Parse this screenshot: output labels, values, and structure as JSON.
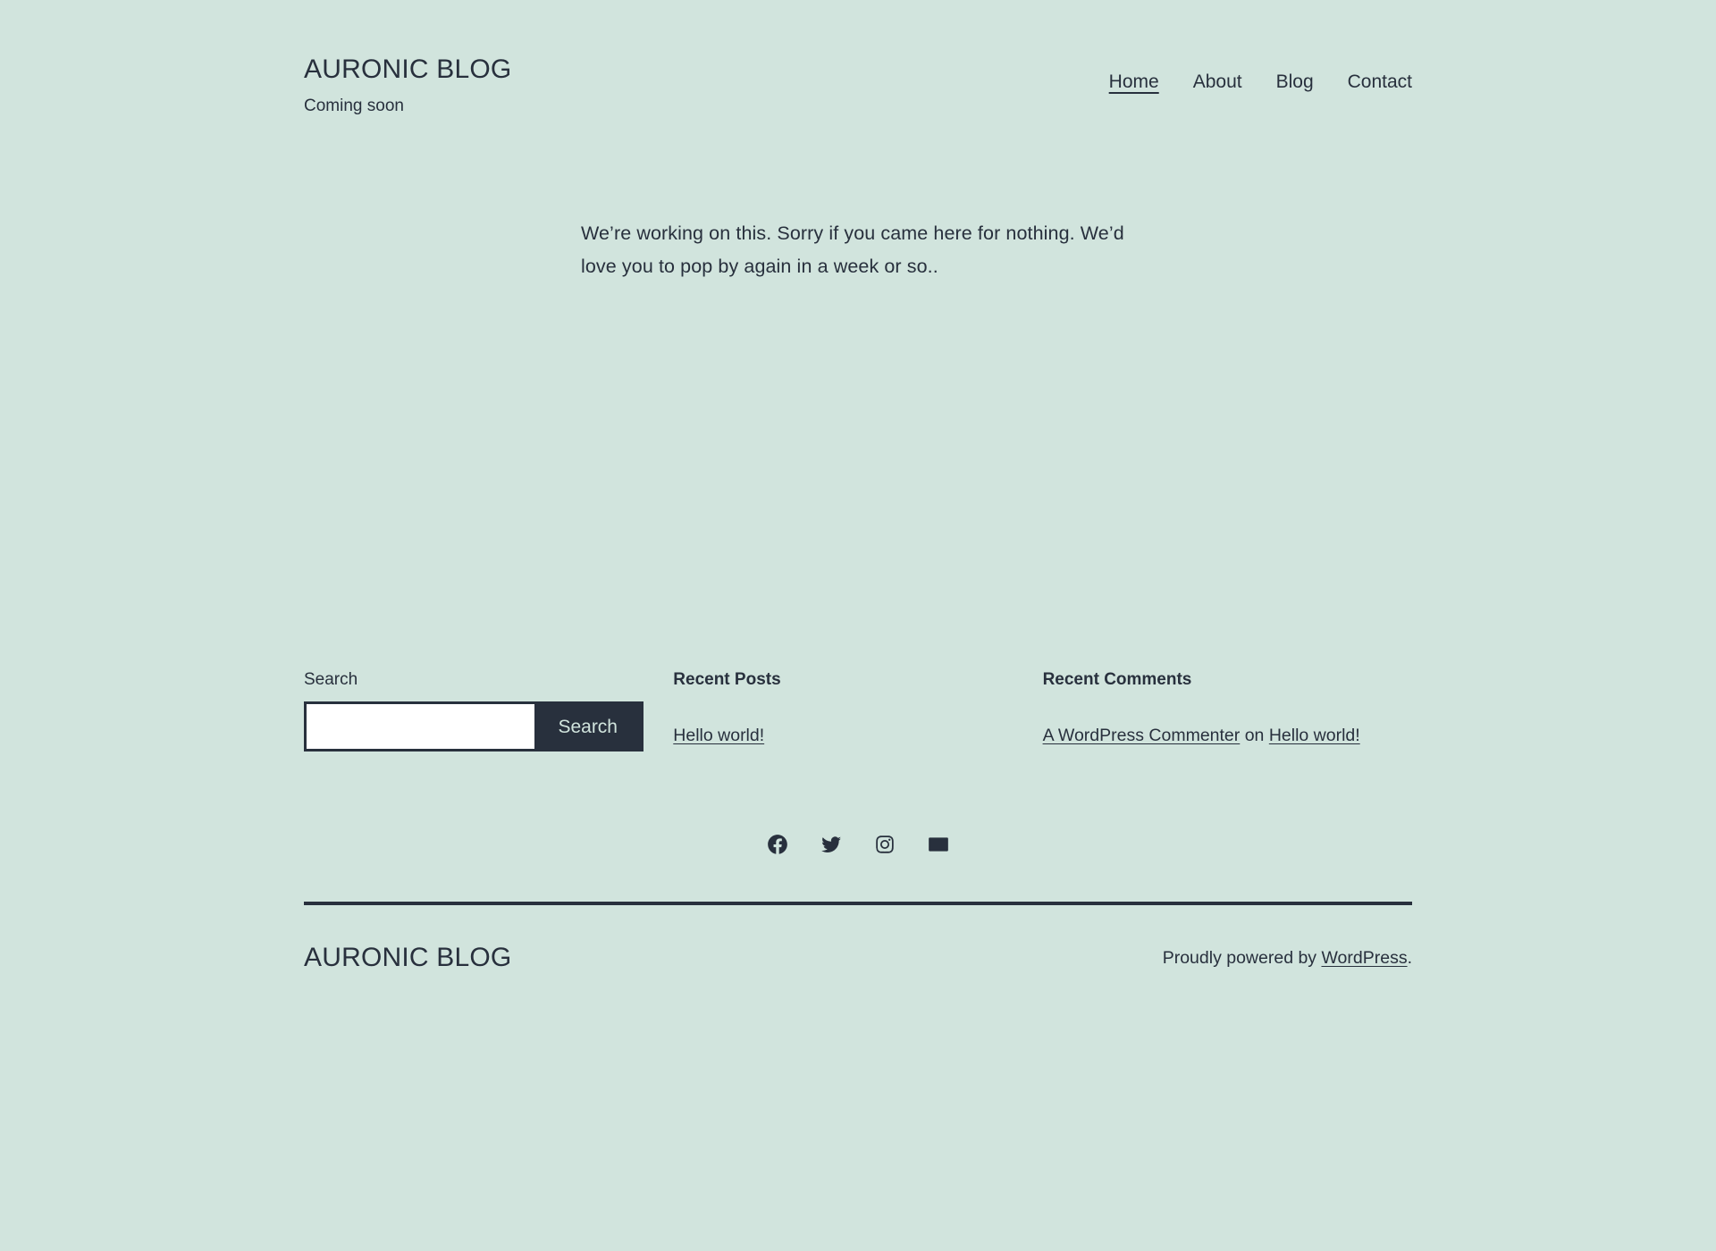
{
  "theme": {
    "background_color": "#d1e4dd",
    "text_color": "#28303d",
    "button_text_color": "#d1e4dd"
  },
  "header": {
    "site_title": "AURONIC BLOG",
    "tagline": "Coming soon",
    "nav": [
      {
        "label": "Home",
        "current": true
      },
      {
        "label": "About",
        "current": false
      },
      {
        "label": "Blog",
        "current": false
      },
      {
        "label": "Contact",
        "current": false
      }
    ]
  },
  "main": {
    "body_text": "We’re working on this. Sorry if you came here for nothing. We’d love you to pop by again in a week or so.."
  },
  "widgets": {
    "search": {
      "label": "Search",
      "input_value": "",
      "placeholder": "",
      "button_label": "Search"
    },
    "recent_posts": {
      "title": "Recent Posts",
      "items": [
        {
          "label": "Hello world!"
        }
      ]
    },
    "recent_comments": {
      "title": "Recent Comments",
      "items": [
        {
          "author": "A WordPress Commenter",
          "connector": " on ",
          "post": "Hello world!"
        }
      ]
    }
  },
  "social": [
    {
      "name": "facebook-icon",
      "label": "Facebook"
    },
    {
      "name": "twitter-icon",
      "label": "Twitter"
    },
    {
      "name": "instagram-icon",
      "label": "Instagram"
    },
    {
      "name": "mail-icon",
      "label": "Email"
    }
  ],
  "footer": {
    "site_title": "AURONIC BLOG",
    "credit_prefix": "Proudly powered by ",
    "credit_link": "WordPress",
    "credit_suffix": "."
  }
}
